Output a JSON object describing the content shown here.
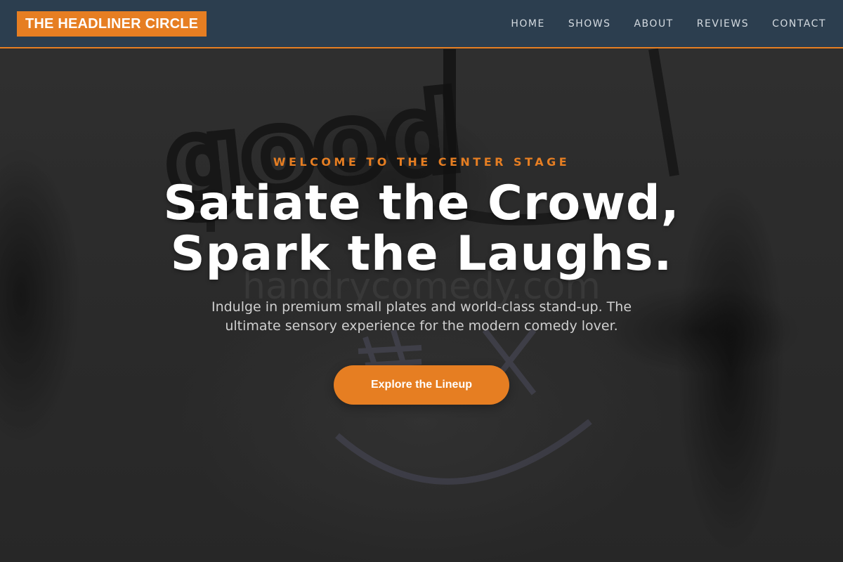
{
  "header": {
    "logo_text": "THE HEADLINER CIRCLE",
    "nav": [
      {
        "label": "HOME"
      },
      {
        "label": "SHOWS"
      },
      {
        "label": "ABOUT"
      },
      {
        "label": "REVIEWS"
      },
      {
        "label": "CONTACT"
      }
    ]
  },
  "hero": {
    "eyebrow": "WELCOME TO THE CENTER STAGE",
    "headline_line1": "Satiate the Crowd,",
    "headline_line2": "Spark the Laughs.",
    "subtext": "Indulge in premium small plates and world-class stand-up. The ultimate sensory experience for the modern comedy lover.",
    "cta_label": "Explore the Lineup",
    "background_graffiti_text": "good",
    "background_watermark_text": "handrycomedy.com"
  },
  "colors": {
    "accent": "#e67e22",
    "header_bg": "#2c3e50",
    "text_primary": "#ffffff",
    "text_muted": "#cfcfcf"
  }
}
